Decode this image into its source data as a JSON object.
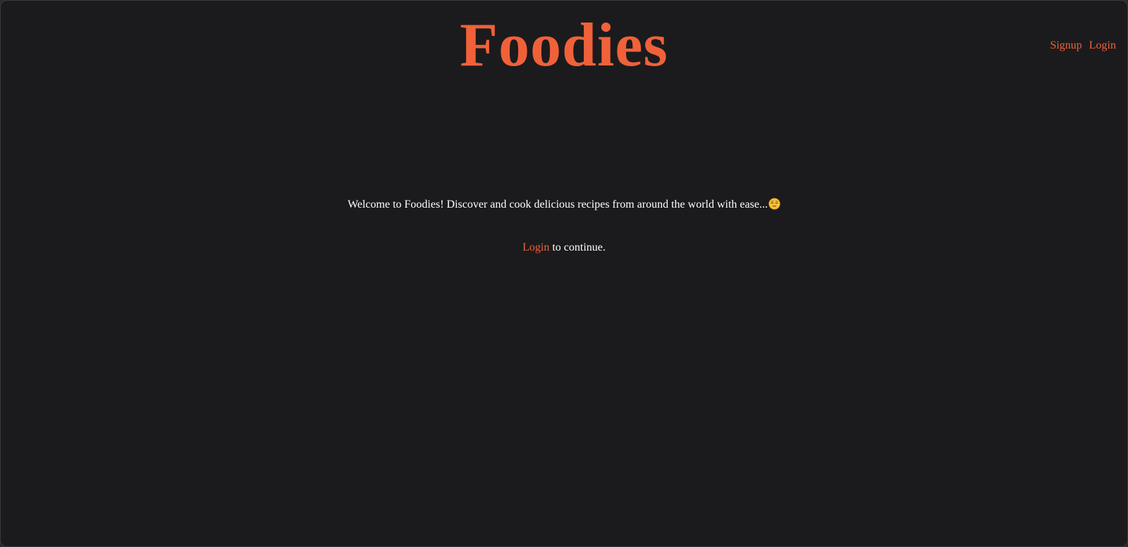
{
  "theme": {
    "accent": "#f0613a",
    "background": "#1b1b1d",
    "text": "#ffffff"
  },
  "header": {
    "brand": "Foodies",
    "nav": {
      "signup_label": "Signup",
      "login_label": "Login"
    }
  },
  "main": {
    "welcome_text": "Welcome to Foodies! Discover and cook delicious recipes from around the world with ease...",
    "welcome_icon": "relieved-face-icon",
    "login_link": "Login",
    "continue_text": " to continue."
  }
}
